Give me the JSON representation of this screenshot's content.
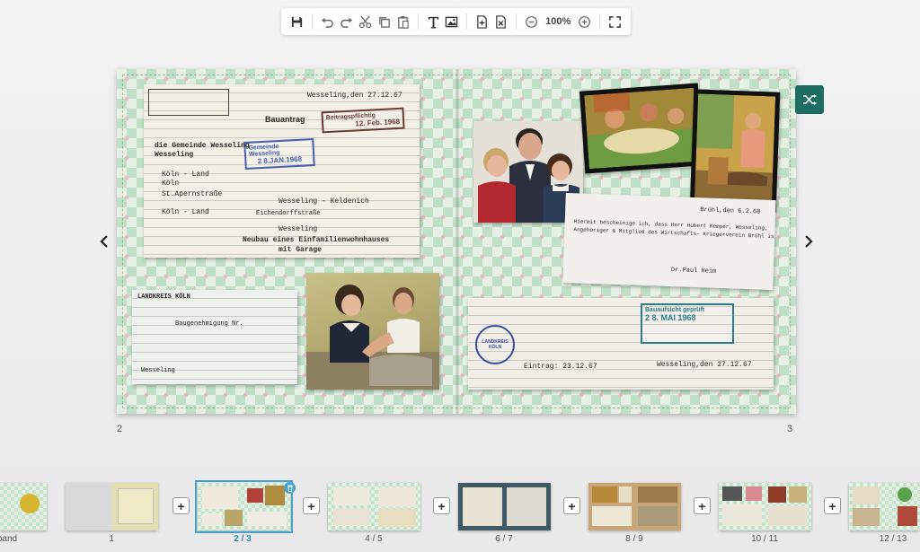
{
  "toolbar": {
    "zoom": "100%",
    "buttons": [
      "save-icon",
      "undo-icon",
      "redo-icon",
      "cut-icon",
      "copy-icon",
      "paste-icon",
      "text-icon",
      "image-icon",
      "add-page-icon",
      "remove-page-icon",
      "zoom-out-icon",
      "zoom-in-icon",
      "fullscreen-icon"
    ]
  },
  "spread": {
    "left_page_number": "2",
    "right_page_number": "3",
    "left": {
      "antrag": {
        "date_line": "Wesseling,den 27.12.67",
        "title": "Bauantrag",
        "stamp_beitrag": "Beitragspflichtig",
        "stamp_date": "12. Feb. 1968",
        "stamp_gemeinde": "Gemeinde Wesseling",
        "stamp_gemeinde_date": "2 8.JAN.1968",
        "line1": "die Gemeinde Wesseling",
        "line2": "Wesseling",
        "line3": "Köln - Land",
        "line4": "Köln",
        "line5": "St.Apernstraße",
        "line6": "Wesseling - Keldenich",
        "line7": "Köln - Land",
        "line8": "Eichendorffstraße",
        "line9": "Wesseling",
        "line10": "Neubau eines Einfamilienwohnhauses",
        "line11": "mit Garage"
      },
      "genehmigung": {
        "header": "LANDKREIS KÖLN",
        "title": "Baugenehmigung Nr.",
        "footer": "Wesseling"
      }
    },
    "right": {
      "letter": {
        "date": "Brühl,den 6.2.68",
        "body1": "Hiermit bescheinige ich, dass Herr Hubert Kemper, Wesseling,",
        "body2": "Angehöriger & Mitglied des Wirtschafts- Kriegerverein Brühl ist.",
        "signature": "Dr.Paul Heim"
      },
      "bauschein": {
        "stamp_title": "Bauaufsicht geprüft",
        "stamp_date": "2 8. MAI 1968",
        "line1": "Wesseling,den 27.12.67",
        "line2": "Eintrag: 23.12.67",
        "seal": "LANDKREIS KÖLN"
      }
    }
  },
  "thumbnails": [
    {
      "label": "band"
    },
    {
      "label": "1"
    },
    {
      "label": "2 / 3",
      "selected": true
    },
    {
      "label": "4 / 5"
    },
    {
      "label": "6 / 7"
    },
    {
      "label": "8 / 9"
    },
    {
      "label": "10 / 11"
    },
    {
      "label": "12 / 13"
    }
  ],
  "colors": {
    "accent": "#4aa3c7",
    "shuffle_button": "#1d6d63"
  }
}
